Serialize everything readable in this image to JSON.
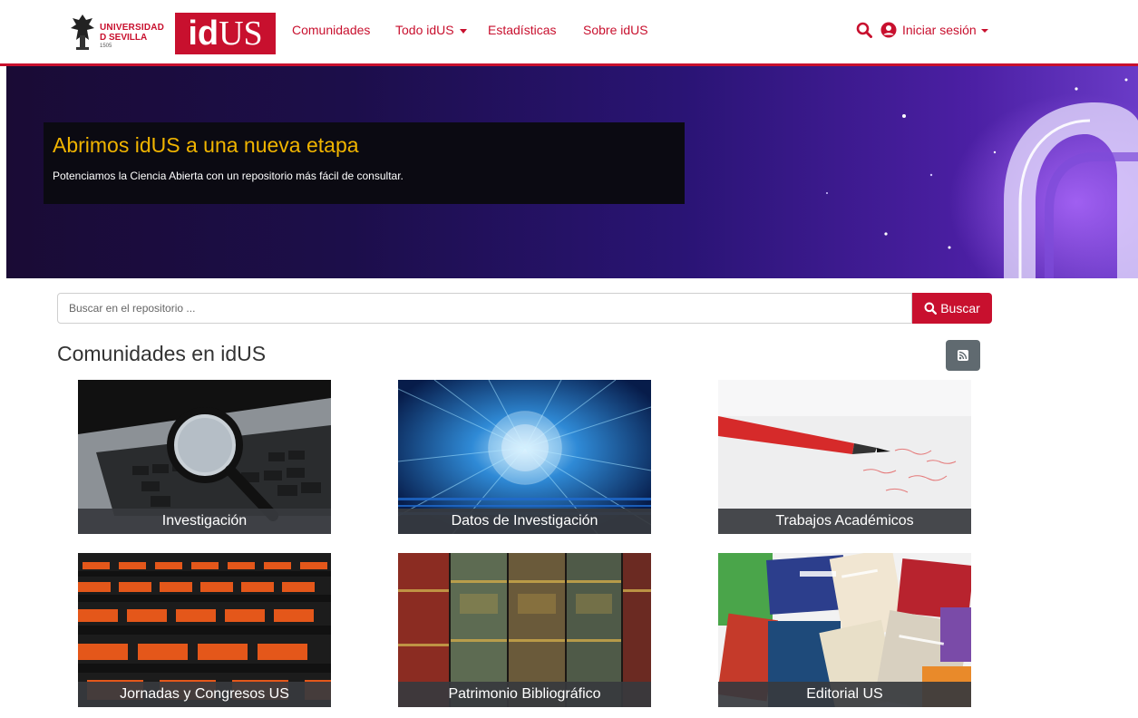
{
  "header": {
    "university_logo": {
      "line1": "UNIVERSIDAD",
      "line2": "D SEVILLA",
      "line3": "1505"
    },
    "idus_logo": {
      "part1": "id",
      "part2": "US"
    },
    "nav": [
      {
        "label": "Comunidades"
      },
      {
        "label": "Todo idUS",
        "dropdown": true
      },
      {
        "label": "Estadísticas"
      },
      {
        "label": "Sobre idUS"
      }
    ],
    "login_label": "Iniciar sesión",
    "icons": [
      "search-icon",
      "user-circle-icon",
      "caret-down-icon"
    ]
  },
  "banner": {
    "title": "Abrimos idUS a una nueva etapa",
    "subtitle": "Potenciamos la Ciencia Abierta con un repositorio más fácil de consultar."
  },
  "search": {
    "placeholder": "Buscar en el repositorio ...",
    "button_label": "Buscar"
  },
  "communities": {
    "title": "Comunidades en idUS",
    "rss_icon": "rss-icon",
    "cards": [
      {
        "label": "Investigación",
        "image": "laptop-magnifier"
      },
      {
        "label": "Datos de Investigación",
        "image": "digital-sphere"
      },
      {
        "label": "Trabajos Académicos",
        "image": "red-pen"
      },
      {
        "label": "Jornadas y Congresos US",
        "image": "orange-seats"
      },
      {
        "label": "Patrimonio Bibliográfico",
        "image": "old-book-spines"
      },
      {
        "label": "Editorial US",
        "image": "book-covers-collage"
      }
    ]
  },
  "colors": {
    "brand_red": "#c8102e",
    "banner_title": "#f0b400",
    "card_label_bg": "#373a3e",
    "rss_button": "#606a70"
  }
}
